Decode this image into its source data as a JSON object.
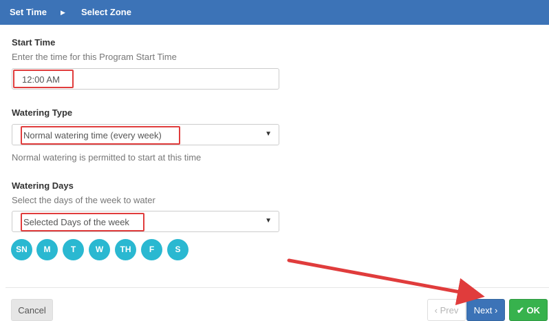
{
  "wizard": {
    "steps": [
      "Set Time",
      "Select Zone"
    ],
    "separator": "▶"
  },
  "start_time": {
    "label": "Start Time",
    "help": "Enter the time for this Program Start Time",
    "value": "12:00 AM"
  },
  "watering_type": {
    "label": "Watering Type",
    "selected": "Normal watering time (every week)",
    "help": "Normal watering is permitted to start at this time"
  },
  "watering_days": {
    "label": "Watering Days",
    "help": "Select the days of the week to water",
    "selected": "Selected Days of the week",
    "days": [
      "SN",
      "M",
      "T",
      "W",
      "TH",
      "F",
      "S"
    ]
  },
  "footer": {
    "cancel": "Cancel",
    "prev": "‹ Prev",
    "next": "Next ›",
    "ok": "OK",
    "ok_icon": "check-icon"
  },
  "colors": {
    "header": "#3c73b7",
    "day_circle": "#2ab8d1",
    "next_button": "#3c73b7",
    "ok_button": "#37b24d",
    "annotation": "#e03c3c"
  }
}
